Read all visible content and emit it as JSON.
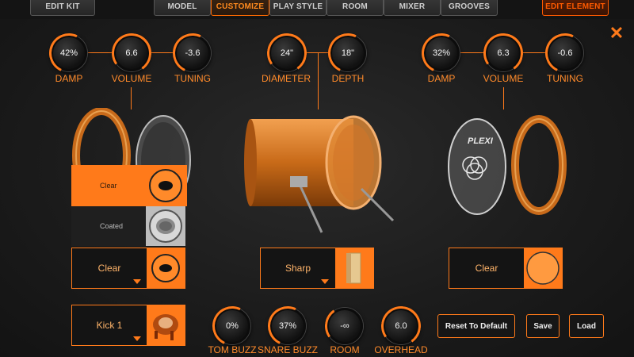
{
  "topbar": {
    "edit_kit": "EDIT KIT",
    "tabs": [
      "MODEL",
      "CUSTOMIZE",
      "PLAY STYLE",
      "ROOM",
      "MIXER",
      "GROOVES"
    ],
    "active_tab": "CUSTOMIZE",
    "edit_element": "EDIT ELEMENT"
  },
  "left": {
    "knobs": [
      {
        "value": "42%",
        "label": "DAMP"
      },
      {
        "value": "6.6",
        "label": "VOLUME"
      },
      {
        "value": "-3.6",
        "label": "TUNING"
      }
    ],
    "head_options": [
      "Clear",
      "Coated"
    ],
    "head_select": "Clear",
    "beater_select": "Kick 1"
  },
  "center": {
    "knobs": [
      {
        "value": "24\"",
        "label": "DIAMETER"
      },
      {
        "value": "18\"",
        "label": "DEPTH"
      }
    ],
    "beater_select": "Sharp"
  },
  "right": {
    "knobs": [
      {
        "value": "32%",
        "label": "DAMP"
      },
      {
        "value": "6.3",
        "label": "VOLUME"
      },
      {
        "value": "-0.6",
        "label": "TUNING"
      }
    ],
    "head_select": "Clear",
    "reso_logo": "PLEXI"
  },
  "bottom": {
    "knobs": [
      {
        "value": "0%",
        "label": "TOM BUZZ"
      },
      {
        "value": "37%",
        "label": "SNARE BUZZ"
      },
      {
        "value": "-∞",
        "label": "ROOM"
      },
      {
        "value": "6.0",
        "label": "OVERHEAD"
      }
    ],
    "buttons": {
      "reset": "Reset To Default",
      "save": "Save",
      "load": "Load"
    }
  },
  "colors": {
    "accent": "#ff7a1a",
    "background": "#1c1c1c"
  }
}
